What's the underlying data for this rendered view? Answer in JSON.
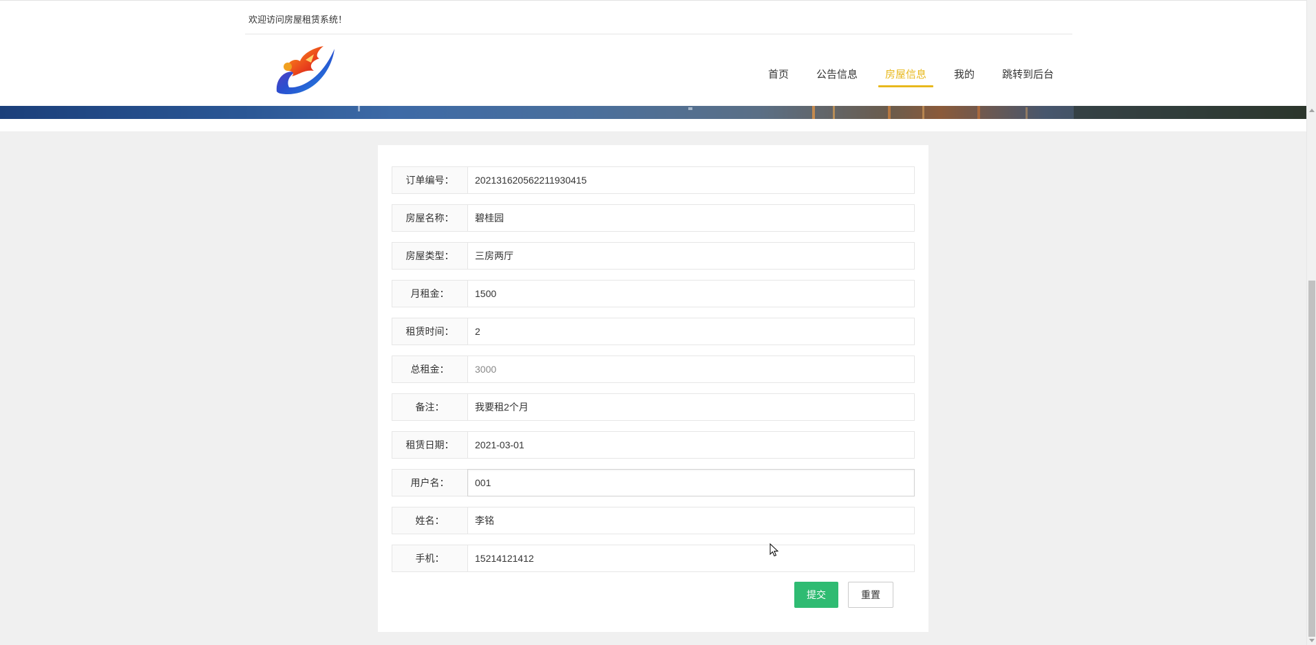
{
  "header": {
    "welcome": "欢迎访问房屋租赁系统！"
  },
  "nav": {
    "items": [
      {
        "label": "首页"
      },
      {
        "label": "公告信息"
      },
      {
        "label": "房屋信息"
      },
      {
        "label": "我的"
      },
      {
        "label": "跳转到后台"
      }
    ],
    "active": "房屋信息",
    "active_color": "#e8b81c"
  },
  "form": {
    "fields": [
      {
        "label": "订单编号：",
        "value": "202131620562211930415"
      },
      {
        "label": "房屋名称：",
        "value": "碧桂园"
      },
      {
        "label": "房屋类型：",
        "value": "三房两厅"
      },
      {
        "label": "月租金：",
        "value": "1500"
      },
      {
        "label": "租赁时间：",
        "value": "2"
      },
      {
        "label": "总租金：",
        "value": "3000"
      },
      {
        "label": "备注：",
        "value": "我要租2个月"
      },
      {
        "label": "租赁日期：",
        "value": "2021-03-01"
      },
      {
        "label": "用户名：",
        "value": "001"
      },
      {
        "label": "姓名：",
        "value": "李铭"
      },
      {
        "label": "手机：",
        "value": "15214121412"
      }
    ],
    "submit_label": "提交",
    "reset_label": "重置",
    "submit_color": "#2fbb72"
  }
}
